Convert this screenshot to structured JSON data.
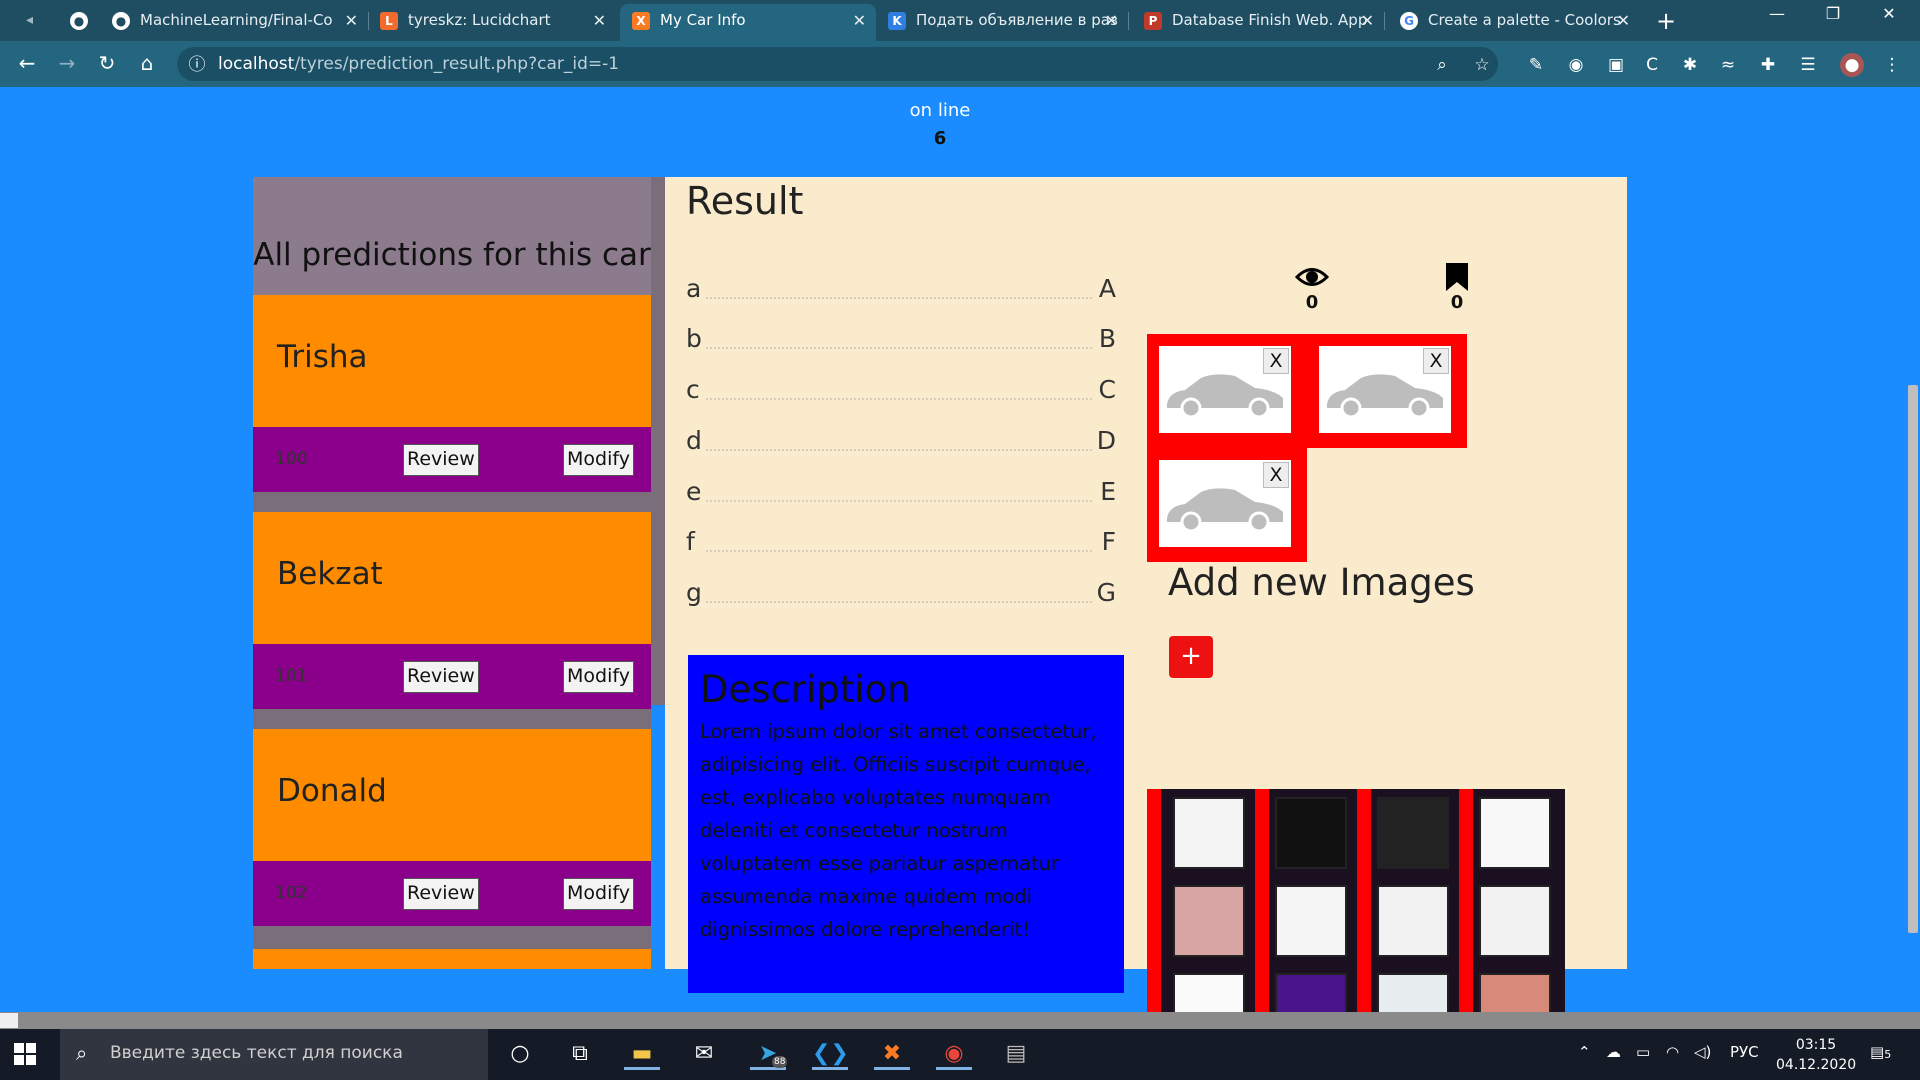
{
  "browser": {
    "tabs": [
      {
        "title": "MachineLearning/Final-Co",
        "icon": "github-icon",
        "active": false
      },
      {
        "title": "tyreskz: Lucidchart",
        "icon": "lucidchart-icon",
        "active": false
      },
      {
        "title": "My Car Info",
        "icon": "xampp-icon",
        "active": true
      },
      {
        "title": "Подать объявление в раз",
        "icon": "kolesa-icon",
        "active": false
      },
      {
        "title": "Database Finish Web. App",
        "icon": "presentation-icon",
        "active": false
      },
      {
        "title": "Create a palette - Coolors",
        "icon": "google-icon",
        "active": false
      }
    ],
    "tab_close": "✕",
    "new_tab": "+",
    "url_host": "localhost",
    "url_path": "/tyres/prediction_result.php?car_id=-1"
  },
  "page": {
    "online_label": "on line",
    "online_count": "6",
    "sidebar": {
      "title": "All predictions for this car",
      "predictions": [
        {
          "name": "Trisha",
          "id": "100",
          "review_label": "Review",
          "modify_label": "Modify"
        },
        {
          "name": "Bekzat",
          "id": "101",
          "review_label": "Review",
          "modify_label": "Modify"
        },
        {
          "name": "Donald",
          "id": "102",
          "review_label": "Review",
          "modify_label": "Modify"
        }
      ]
    },
    "result": {
      "title": "Result",
      "specs": [
        {
          "key": "a",
          "value": "A"
        },
        {
          "key": "b",
          "value": "B"
        },
        {
          "key": "c",
          "value": "C"
        },
        {
          "key": "d",
          "value": "D"
        },
        {
          "key": "e",
          "value": "E"
        },
        {
          "key": "f",
          "value": "F"
        },
        {
          "key": "g",
          "value": "G"
        }
      ],
      "views_count": "0",
      "bookmarks_count": "0",
      "image_remove_label": "X",
      "add_images_title": "Add new Images",
      "add_button_label": "+",
      "description_title": "Description",
      "description_text": "Lorem ipsum dolor sit amet consectetur, adipisicing elit. Officiis suscipit cumque, est, explicabo voluptates numquam deleniti et consectetur nostrum voluptatem esse pariatur aspernatur assumenda maxime quidem modi dignissimos dolore reprehenderit!"
    }
  },
  "taskbar": {
    "search_placeholder": "Введите здесь текст для поиска",
    "language": "РУС",
    "time": "03:15",
    "date": "04.12.2020",
    "notifications": "5",
    "telegram_badge": "88"
  },
  "colors": {
    "page_bg": "#1a8cff",
    "card_orange": "#ff8c00",
    "card_purple": "#8b008b",
    "main_bg": "#faebcc",
    "description_bg": "#0000ff",
    "image_frame": "#ff0000"
  }
}
